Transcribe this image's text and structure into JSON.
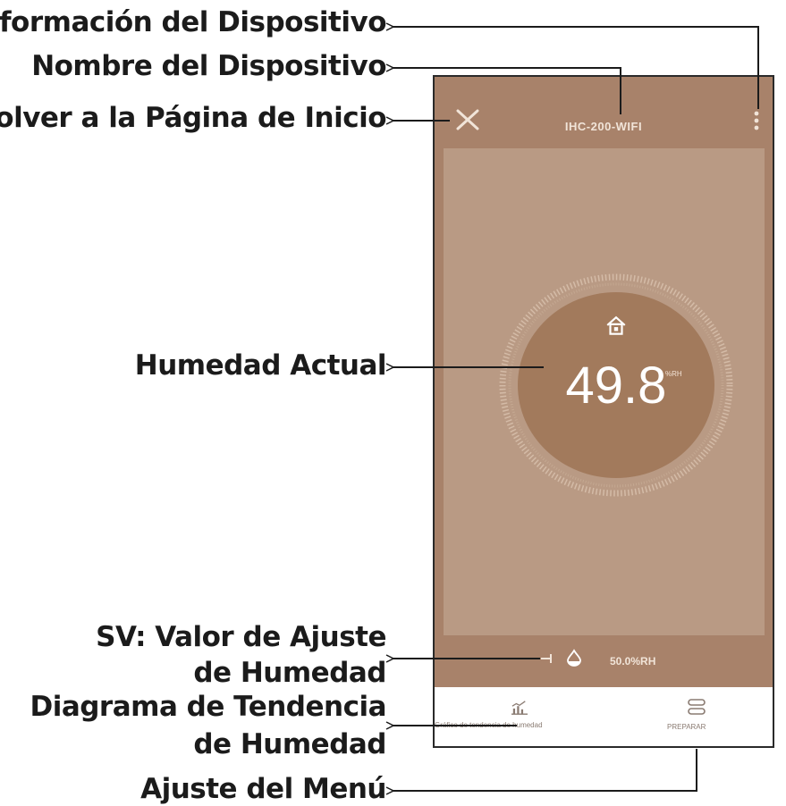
{
  "labels": {
    "device_info": "Información del Dispositivo",
    "device_name": "Nombre del Dispositivo",
    "back_home": "Volver a la Página de Inicio",
    "current_humidity": "Humedad Actual",
    "sv_line1": "SV: Valor de Ajuste",
    "sv_line2": "de Humedad",
    "trend_line1": "Diagrama de Tendencia",
    "trend_line2": "de Humedad",
    "menu_setting": "Ajuste del Menú"
  },
  "app": {
    "device_name": "IHC-200-WIFI",
    "humidity_value": "49.8",
    "humidity_unit": "%RH",
    "setpoint": "50.0%RH",
    "nav_trend": "Gráfico de tendencia de humedad",
    "nav_menu": "PREPARAR"
  },
  "colors": {
    "header": "#a8826a",
    "panel": "#b99a84",
    "dial": "#a27a5c"
  }
}
